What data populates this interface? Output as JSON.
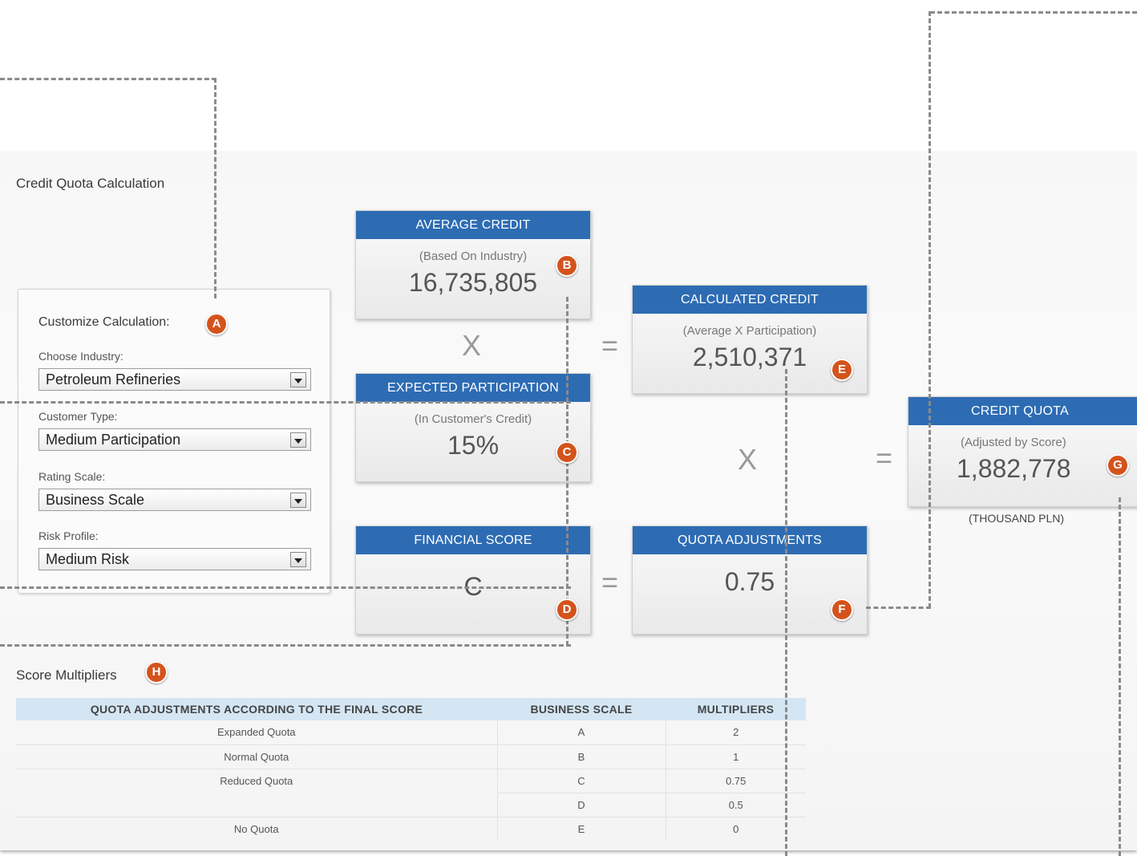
{
  "sections": {
    "credit_quota_calculation": "Credit Quota Calculation",
    "score_multipliers": "Score Multipliers"
  },
  "customize": {
    "title": "Customize Calculation:",
    "fields": [
      {
        "label": "Choose Industry:",
        "value": "Petroleum Refineries"
      },
      {
        "label": "Customer Type:",
        "value": "Medium Participation"
      },
      {
        "label": "Rating Scale:",
        "value": "Business Scale"
      },
      {
        "label": "Risk Profile:",
        "value": "Medium Risk"
      }
    ]
  },
  "cards": {
    "average_credit": {
      "title": "AVERAGE CREDIT",
      "subtitle": "(Based On Industry)",
      "value": "16,735,805"
    },
    "expected_participation": {
      "title": "EXPECTED PARTICIPATION",
      "subtitle": "(In Customer's Credit)",
      "value": "15%"
    },
    "financial_score": {
      "title": "FINANCIAL SCORE",
      "value": "C"
    },
    "calculated_credit": {
      "title": "CALCULATED CREDIT",
      "subtitle": "(Average X Participation)",
      "value": "2,510,371"
    },
    "quota_adjustments": {
      "title": "QUOTA ADJUSTMENTS",
      "value": "0.75"
    },
    "credit_quota": {
      "title": "CREDIT QUOTA",
      "subtitle": "(Adjusted by Score)",
      "value": "1,882,778",
      "unit": "(THOUSAND PLN)"
    }
  },
  "operators": {
    "multiply": "X",
    "equals": "="
  },
  "badges": {
    "a": "A",
    "b": "B",
    "c": "C",
    "d": "D",
    "e": "E",
    "f": "F",
    "g": "G",
    "h": "H"
  },
  "multipliers_table": {
    "headers": [
      "QUOTA ADJUSTMENTS ACCORDING TO THE FINAL SCORE",
      "BUSINESS SCALE",
      "MULTIPLIERS"
    ],
    "rows": [
      [
        "Expanded Quota",
        "A",
        "2"
      ],
      [
        "Normal Quota",
        "B",
        "1"
      ],
      [
        "Reduced Quota",
        "C",
        "0.75"
      ],
      [
        "",
        "D",
        "0.5"
      ],
      [
        "No Quota",
        "E",
        "0"
      ]
    ]
  },
  "colors": {
    "header_blue": "#2d6cb3",
    "badge_orange": "#d4531c",
    "table_header": "#d4e6f4"
  }
}
